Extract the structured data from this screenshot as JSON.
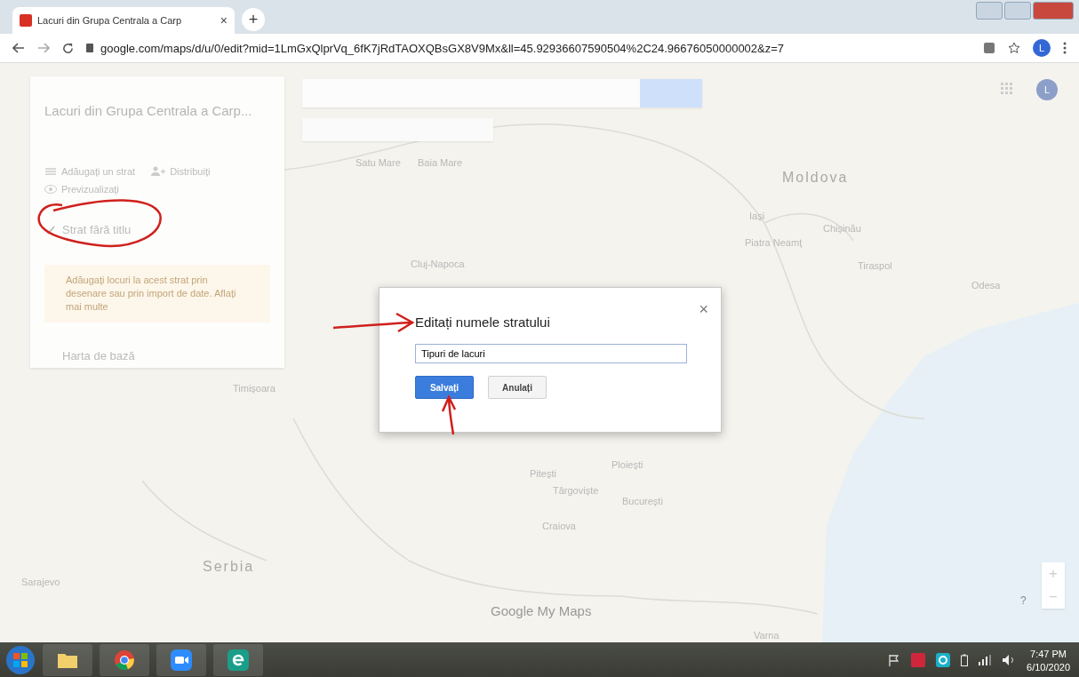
{
  "browser": {
    "tab_title": "Lacuri din Grupa Centrala a Carp",
    "tab_close": "×",
    "new_tab": "+",
    "url": "google.com/maps/d/u/0/edit?mid=1LmGxQlprVq_6fK7jRdTAOXQBsGX8V9Mx&ll=45.92936607590504%2C24.96676050000002&z=7",
    "profile_initial": "L"
  },
  "map_account": {
    "initial": "L"
  },
  "map_panel": {
    "title": "Lacuri din Grupa Centrala a Carp...",
    "actions": [
      {
        "label": "Adăugați un strat",
        "kind": "layer"
      },
      {
        "label": "Distribuiți",
        "kind": "share"
      },
      {
        "label": "Previzualizați",
        "kind": "preview"
      }
    ],
    "layer": {
      "name": "Strat fără titlu",
      "checked": true
    },
    "hint": "Adăugați locuri la acest strat prin desenare sau prin import de date. Aflați mai multe",
    "base_map": "Harta de bază"
  },
  "map_labels": [
    {
      "text": "Satu Mare",
      "kind": "city"
    },
    {
      "text": "Baia Mare",
      "kind": "city"
    },
    {
      "text": "Moldova",
      "kind": "country"
    },
    {
      "text": "Iași",
      "kind": "city"
    },
    {
      "text": "Chișinău",
      "kind": "city"
    },
    {
      "text": "Cluj-Napoca",
      "kind": "city"
    },
    {
      "text": "Piatra Neamț",
      "kind": "city"
    },
    {
      "text": "Tiraspol",
      "kind": "city"
    },
    {
      "text": "Odesa",
      "kind": "city"
    },
    {
      "text": "Timișoara",
      "kind": "city"
    },
    {
      "text": "Ploiești",
      "kind": "city"
    },
    {
      "text": "Pitești",
      "kind": "city"
    },
    {
      "text": "Târgoviște",
      "kind": "city"
    },
    {
      "text": "București",
      "kind": "city"
    },
    {
      "text": "Craiova",
      "kind": "city"
    },
    {
      "text": "Serbia",
      "kind": "country"
    },
    {
      "text": "Sarajevo",
      "kind": "city"
    },
    {
      "text": "Varna",
      "kind": "city"
    }
  ],
  "map_brand": "Google My Maps",
  "zoom_controls": {
    "plus": "+",
    "minus": "−",
    "help": "?"
  },
  "dialog": {
    "title": "Editați numele stratului",
    "close": "×",
    "value": "Tipuri de lacuri",
    "buttons": [
      {
        "label": "Salvați",
        "kind": "primary"
      },
      {
        "label": "Anulați",
        "kind": "secondary"
      }
    ]
  },
  "taskbar": {
    "time": "7:47 PM",
    "date": "6/10/2020"
  }
}
